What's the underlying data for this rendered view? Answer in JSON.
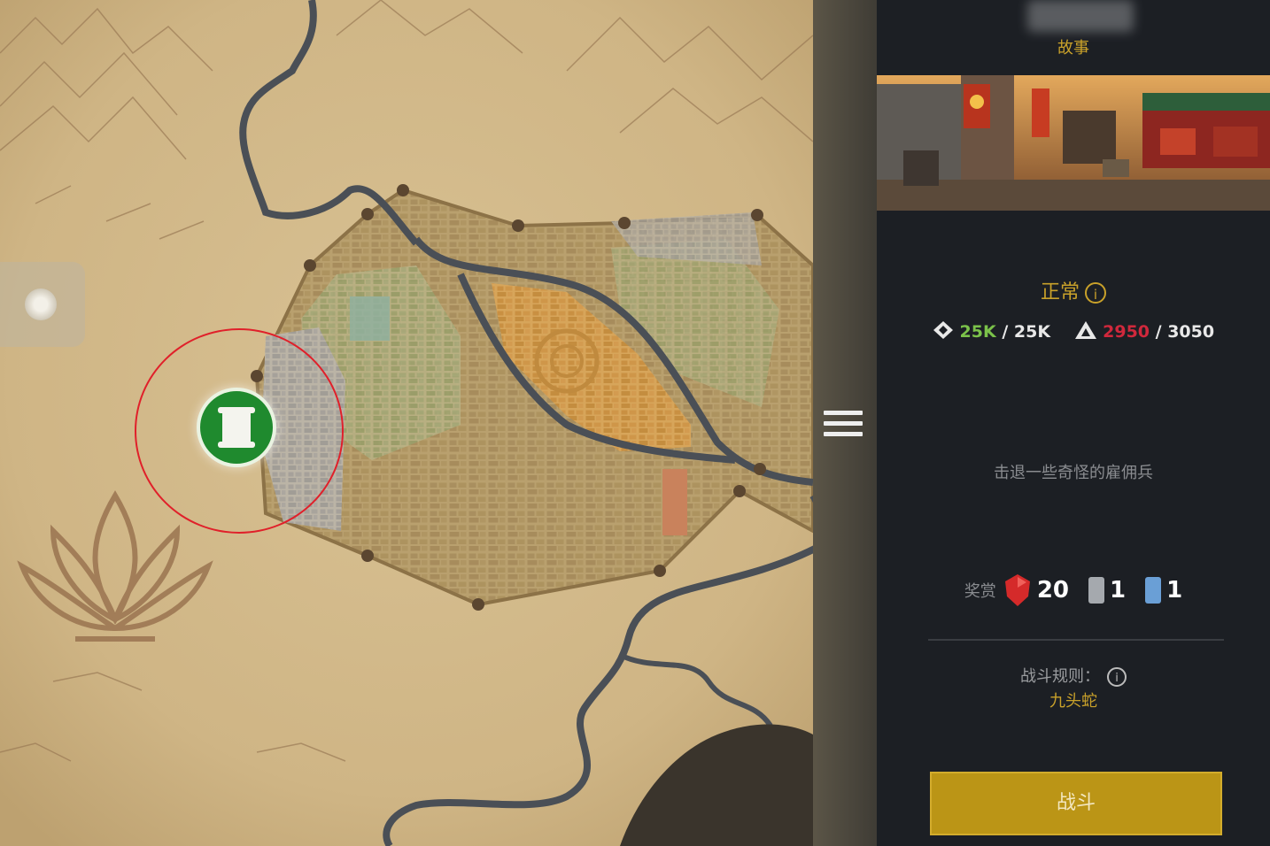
{
  "panel": {
    "story_label": "故事",
    "difficulty_label": "正常",
    "power_current": "25K",
    "power_max": "25K",
    "troop_current": "2950",
    "troop_max": "3050",
    "objective": "击退一些奇怪的雇佣兵",
    "rewards_label": "奖赏",
    "reward_gem_count": "20",
    "reward_card_grey_count": "1",
    "reward_card_blue_count": "1",
    "rules_label": "战斗规则：",
    "rules_value": "九头蛇",
    "fight_button": "战斗"
  },
  "map": {
    "selected_node": "scroll-node",
    "selection_ring_color": "#e0202a",
    "node_color": "#1f8a2e"
  },
  "colors": {
    "accent_gold": "#c9a12a",
    "power_green": "#7bc24a",
    "troop_red": "#d0283c",
    "panel_bg": "#1c1f24"
  }
}
